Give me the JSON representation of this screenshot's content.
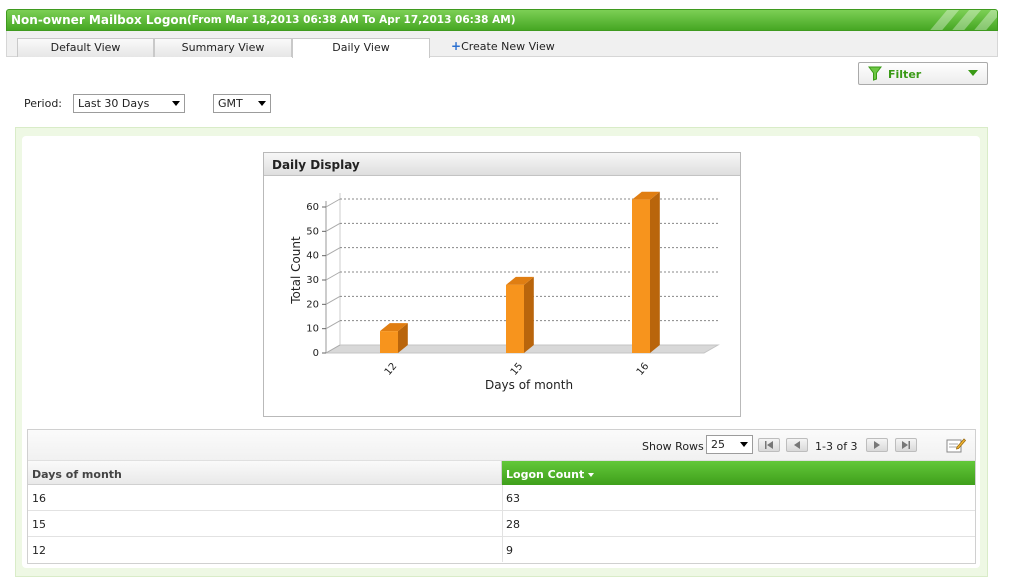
{
  "header": {
    "title": "Non-owner Mailbox Logon",
    "subtitle": "(From Mar 18,2013 06:38 AM To Apr 17,2013 06:38 AM)"
  },
  "tabs": [
    {
      "label": "Default View",
      "active": false
    },
    {
      "label": "Summary View",
      "active": false
    },
    {
      "label": "Daily View",
      "active": true
    }
  ],
  "create_view_label": "Create New View",
  "filter": {
    "label": "Filter",
    "icon": "funnel-icon"
  },
  "period": {
    "label": "Period:",
    "value": "Last 30 Days",
    "timezone": "GMT"
  },
  "chart_title": "Daily Display",
  "chart_data": {
    "type": "bar",
    "categories": [
      "12",
      "15",
      "16"
    ],
    "values": [
      9,
      28,
      63
    ],
    "title": "Daily Display",
    "xlabel": "Days of month",
    "ylabel": "Total Count",
    "ylim": [
      0,
      60
    ],
    "yticks": [
      0,
      10,
      20,
      30,
      40,
      50,
      60
    ],
    "grid": true,
    "bar_color": "#f7941d",
    "bar_side_color": "#b9650c"
  },
  "table": {
    "show_rows_label": "Show Rows",
    "rows_per_page": "25",
    "page_info": "1-3 of 3",
    "columns": [
      "Days of month",
      "Logon Count"
    ],
    "rows": [
      [
        "16",
        "63"
      ],
      [
        "15",
        "28"
      ],
      [
        "12",
        "9"
      ]
    ]
  },
  "colors": {
    "accent": "#46a723"
  }
}
